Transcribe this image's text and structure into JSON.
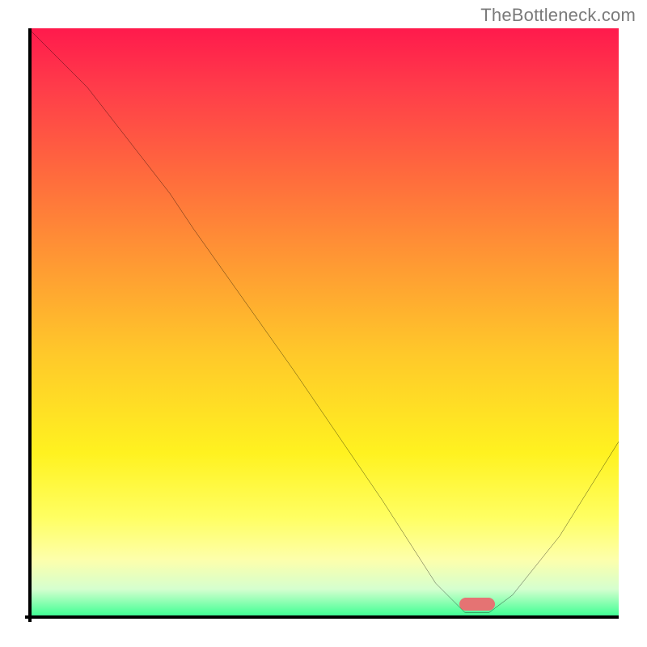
{
  "watermark": "TheBottleneck.com",
  "chart_data": {
    "type": "line",
    "title": "",
    "xlabel": "",
    "ylabel": "",
    "xlim": [
      0,
      100
    ],
    "ylim": [
      0,
      100
    ],
    "x": [
      0,
      10,
      24,
      28,
      45,
      60,
      69,
      74,
      78,
      82,
      90,
      100
    ],
    "values": [
      100,
      90,
      72,
      66,
      42,
      20,
      6,
      1,
      1,
      4,
      14,
      30
    ],
    "annotations": [
      {
        "kind": "marker-pill",
        "x": 76,
        "y": 2.4,
        "color": "#e57373"
      }
    ],
    "background_gradient_stops": [
      {
        "pos": 0,
        "color": "#ff1a4c"
      },
      {
        "pos": 10,
        "color": "#ff3c4a"
      },
      {
        "pos": 25,
        "color": "#ff6b3d"
      },
      {
        "pos": 40,
        "color": "#ff9a33"
      },
      {
        "pos": 55,
        "color": "#ffc82a"
      },
      {
        "pos": 72,
        "color": "#fff220"
      },
      {
        "pos": 83,
        "color": "#ffff63"
      },
      {
        "pos": 90,
        "color": "#fdffab"
      },
      {
        "pos": 95,
        "color": "#d5ffcf"
      },
      {
        "pos": 100,
        "color": "#2fff8d"
      }
    ]
  }
}
